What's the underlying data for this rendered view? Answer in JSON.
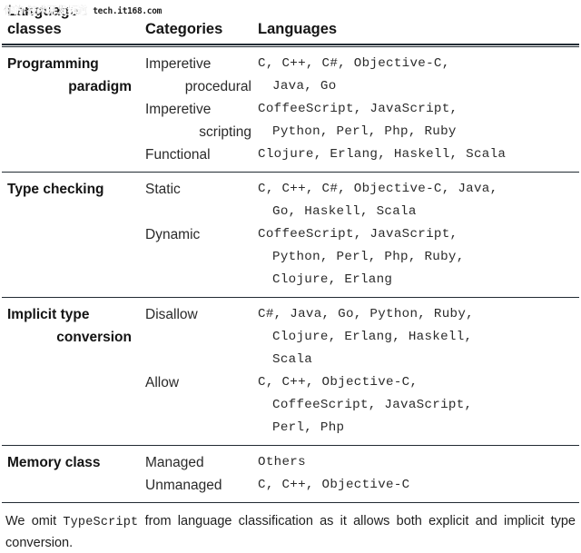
{
  "watermark": {
    "cn_text": "你的·技术开发频道",
    "url_text": "tech.it168.com"
  },
  "table": {
    "headers": {
      "col1_line1": "Language",
      "col1_line2": "classes",
      "col2": "Categories",
      "col3": "Languages"
    },
    "rows": [
      {
        "class_line1": "Programming",
        "class_line2": "paradigm",
        "groups": [
          {
            "category_line1": "Imperetive",
            "category_line2": "procedural",
            "languages": [
              "C, C++, C#, Objective-C,",
              "Java, Go"
            ]
          },
          {
            "category_line1": "Imperetive",
            "category_line2": "scripting",
            "languages": [
              "CoffeeScript, JavaScript,",
              "Python, Perl, Php, Ruby"
            ]
          },
          {
            "category_line1": "Functional",
            "category_line2": "",
            "languages": [
              "Clojure, Erlang, Haskell, Scala"
            ]
          }
        ]
      },
      {
        "class_line1": "Type checking",
        "class_line2": "",
        "groups": [
          {
            "category_line1": "Static",
            "category_line2": "",
            "languages": [
              "C, C++, C#, Objective-C, Java,",
              "Go, Haskell, Scala"
            ]
          },
          {
            "category_line1": "Dynamic",
            "category_line2": "",
            "languages": [
              "CoffeeScript, JavaScript,",
              "Python, Perl, Php, Ruby,",
              "Clojure, Erlang"
            ]
          }
        ]
      },
      {
        "class_line1": "Implicit type",
        "class_line2": "conversion",
        "groups": [
          {
            "category_line1": "Disallow",
            "category_line2": "",
            "languages": [
              "C#, Java, Go, Python, Ruby,",
              "Clojure, Erlang, Haskell,",
              "Scala"
            ]
          },
          {
            "category_line1": "Allow",
            "category_line2": "",
            "languages": [
              "C, C++, Objective-C,",
              "CoffeeScript, JavaScript,",
              "Perl, Php"
            ]
          }
        ]
      },
      {
        "class_line1": "Memory class",
        "class_line2": "",
        "groups": [
          {
            "category_line1": "Managed",
            "category_line2": "",
            "languages": [
              "Others"
            ]
          },
          {
            "category_line1": "Unmanaged",
            "category_line2": "",
            "languages": [
              "C, C++, Objective-C"
            ]
          }
        ]
      }
    ]
  },
  "footnote": {
    "part1": "We omit ",
    "mono": "TypeScript",
    "part2": " from language classification as it allows both explicit and implicit type conversion."
  }
}
